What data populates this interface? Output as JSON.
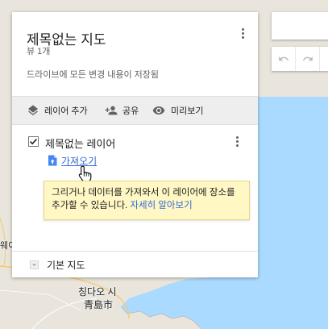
{
  "map_title": "제목없는 지도",
  "view_count": "뷰 1개",
  "save_status": "드라이브에 모든 변경 내용이 저장됨",
  "toolbar": {
    "add_layer": "레이어 추가",
    "share": "공유",
    "preview": "미리보기"
  },
  "layer": {
    "name": "제목없는 레이어",
    "checked": true,
    "import_label": "가져오기"
  },
  "tooltip": {
    "text": "그리거나 데이터를 가져와서 이 레이어에 장소를 추가할 수 있습니다. ",
    "learn_more": "자세히 알아보기"
  },
  "base_map": "기본 지도",
  "map_labels": {
    "city_ko": "칭다오 시",
    "city_zh": "青島市",
    "left_edge": "웨이"
  },
  "colors": {
    "land": "#e9e5dc",
    "water": "#aadaff",
    "link": "#3367d6",
    "tooltip_bg": "#fff8c4"
  }
}
